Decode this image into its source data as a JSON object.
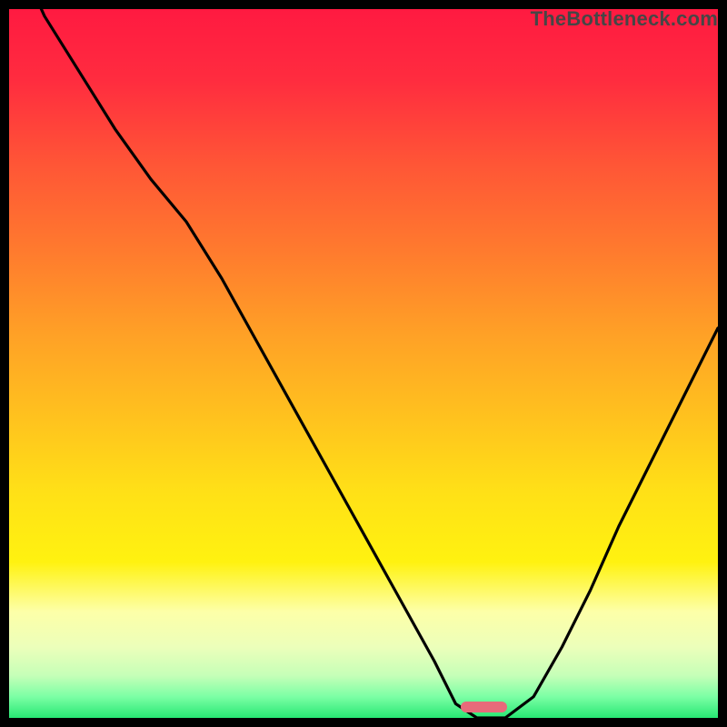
{
  "watermark": "TheBottleneck.com",
  "gradient_stops": [
    {
      "offset": 0,
      "color": "#ff1a41"
    },
    {
      "offset": 0.1,
      "color": "#ff2c3f"
    },
    {
      "offset": 0.22,
      "color": "#ff5636"
    },
    {
      "offset": 0.34,
      "color": "#ff7a2e"
    },
    {
      "offset": 0.46,
      "color": "#ffa126"
    },
    {
      "offset": 0.58,
      "color": "#ffc31e"
    },
    {
      "offset": 0.68,
      "color": "#ffe017"
    },
    {
      "offset": 0.78,
      "color": "#fff210"
    },
    {
      "offset": 0.85,
      "color": "#fdffa8"
    },
    {
      "offset": 0.9,
      "color": "#ecffba"
    },
    {
      "offset": 0.94,
      "color": "#c6ffb8"
    },
    {
      "offset": 0.97,
      "color": "#7cffa5"
    },
    {
      "offset": 1.0,
      "color": "#27e773"
    }
  ],
  "marker": {
    "x_frac": 0.67,
    "y_frac": 0.985,
    "width_frac": 0.065,
    "height_frac": 0.015,
    "color": "#e86a7a"
  },
  "chart_data": {
    "type": "line",
    "title": "",
    "xlabel": "",
    "ylabel": "",
    "xlim": [
      0,
      1
    ],
    "ylim": [
      0,
      1
    ],
    "series": [
      {
        "name": "curve",
        "x": [
          0.0,
          0.05,
          0.1,
          0.15,
          0.2,
          0.25,
          0.3,
          0.35,
          0.4,
          0.45,
          0.5,
          0.55,
          0.6,
          0.63,
          0.66,
          0.7,
          0.74,
          0.78,
          0.82,
          0.86,
          0.9,
          0.95,
          1.0
        ],
        "y": [
          1.1,
          0.99,
          0.91,
          0.83,
          0.76,
          0.7,
          0.62,
          0.53,
          0.44,
          0.35,
          0.26,
          0.17,
          0.08,
          0.02,
          0.0,
          0.0,
          0.03,
          0.1,
          0.18,
          0.27,
          0.35,
          0.45,
          0.55
        ]
      }
    ],
    "annotations": [
      {
        "text": "TheBottleneck.com",
        "position": "top-right"
      }
    ]
  }
}
